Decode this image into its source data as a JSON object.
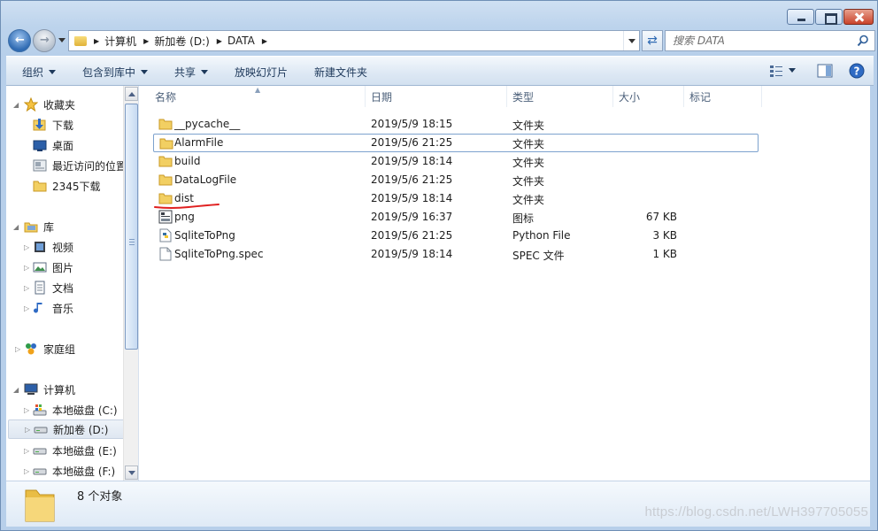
{
  "window": {
    "caption_buttons": [
      "minimize",
      "maximize",
      "close"
    ]
  },
  "address_bar": {
    "breadcrumbs": [
      "计算机",
      "新加卷 (D:)",
      "DATA"
    ]
  },
  "search": {
    "placeholder": "搜索 DATA"
  },
  "toolbar": {
    "organize": "组织",
    "include_in_library": "包含到库中",
    "share": "共享",
    "slideshow": "放映幻灯片",
    "new_folder": "新建文件夹"
  },
  "nav_pane": {
    "favorites": {
      "label": "收藏夹",
      "items": [
        "下载",
        "桌面",
        "最近访问的位置",
        "2345下载"
      ]
    },
    "libraries": {
      "label": "库",
      "items": [
        "视频",
        "图片",
        "文档",
        "音乐"
      ]
    },
    "homegroup": {
      "label": "家庭组"
    },
    "computer": {
      "label": "计算机",
      "items": [
        "本地磁盘 (C:)",
        "新加卷 (D:)",
        "本地磁盘 (E:)",
        "本地磁盘 (F:)"
      ]
    }
  },
  "columns": {
    "name": "名称",
    "date": "日期",
    "type": "类型",
    "size": "大小",
    "tags": "标记"
  },
  "files": [
    {
      "name": "__pycache__",
      "date": "2019/5/9 18:15",
      "type": "文件夹",
      "size": "",
      "icon": "folder-icon"
    },
    {
      "name": "AlarmFile",
      "date": "2019/5/6 21:25",
      "type": "文件夹",
      "size": "",
      "icon": "folder-icon"
    },
    {
      "name": "build",
      "date": "2019/5/9 18:14",
      "type": "文件夹",
      "size": "",
      "icon": "folder-icon"
    },
    {
      "name": "DataLogFile",
      "date": "2019/5/6 21:25",
      "type": "文件夹",
      "size": "",
      "icon": "folder-icon"
    },
    {
      "name": "dist",
      "date": "2019/5/9 18:14",
      "type": "文件夹",
      "size": "",
      "icon": "folder-icon"
    },
    {
      "name": "png",
      "date": "2019/5/9 16:37",
      "type": "图标",
      "size": "67 KB",
      "icon": "image-file-icon"
    },
    {
      "name": "SqliteToPng",
      "date": "2019/5/6 21:25",
      "type": "Python File",
      "size": "3 KB",
      "icon": "python-file-icon"
    },
    {
      "name": "SqliteToPng.spec",
      "date": "2019/5/9 18:14",
      "type": "SPEC 文件",
      "size": "1 KB",
      "icon": "document-file-icon"
    }
  ],
  "status_bar": {
    "count_text": "8 个对象"
  },
  "watermark": "https://blog.csdn.net/LWH397705055",
  "colors": {
    "selection_border": "#7da2ce",
    "annotation_underline": "#e02020"
  }
}
